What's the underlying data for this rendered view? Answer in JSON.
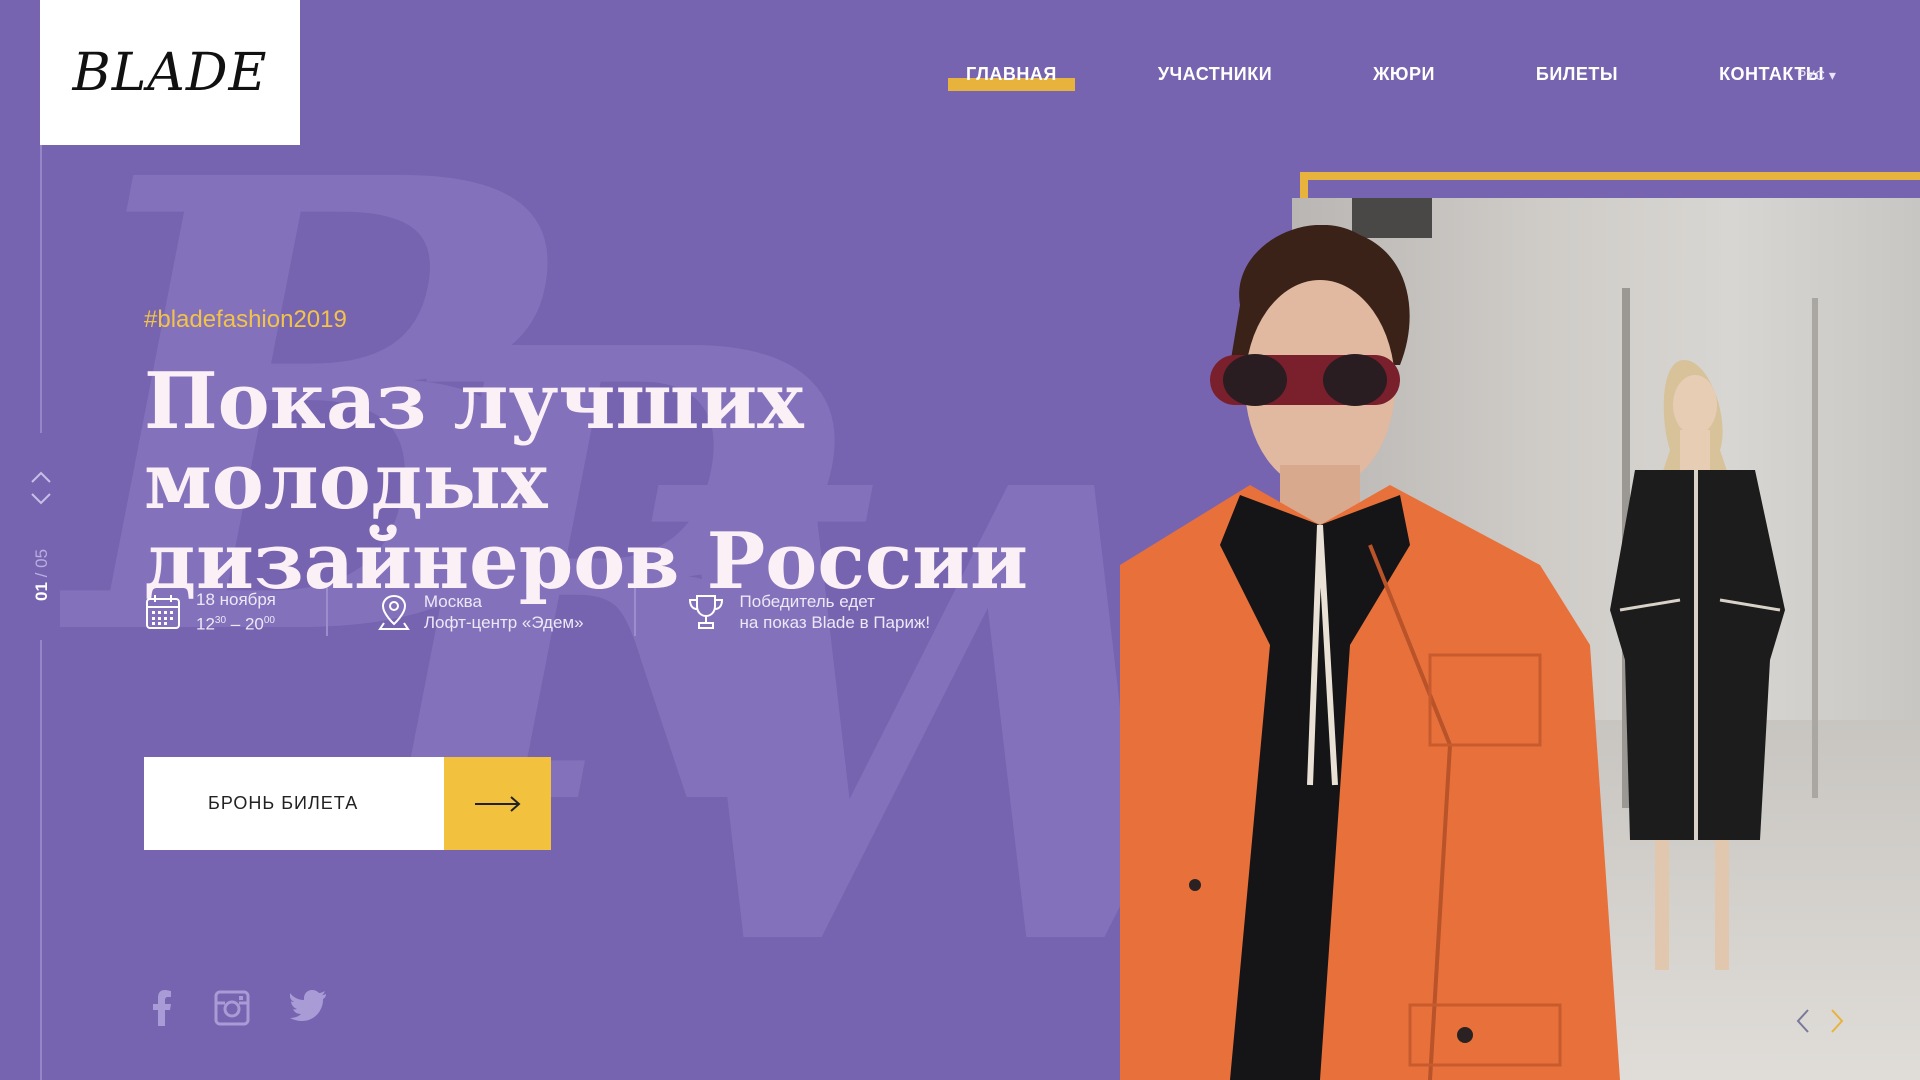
{
  "logo": {
    "text": "BLADE"
  },
  "nav": {
    "items": [
      {
        "label": "ГЛАВНАЯ",
        "active": true
      },
      {
        "label": "УЧАСТНИКИ"
      },
      {
        "label": "ЖЮРИ"
      },
      {
        "label": "БИЛЕТЫ"
      },
      {
        "label": "КОНТАКТЫ"
      }
    ],
    "language": "РУС ▾"
  },
  "background_letters": [
    "B",
    "R",
    "W"
  ],
  "slide_counter": {
    "current": "01",
    "separator": "/",
    "total": "05"
  },
  "hero": {
    "hashtag": "#bladefashion2019",
    "headline_line1": "Показ лучших молодых",
    "headline_line2": "дизайнеров России"
  },
  "info": {
    "date": {
      "line1": "18 ноября",
      "start_hour": "12",
      "start_min": "30",
      "dash": " – ",
      "end_hour": "20",
      "end_min": "00",
      "icon": "calendar-icon"
    },
    "location": {
      "line1": "Москва",
      "line2": "Лофт-центр «Эдем»",
      "icon": "location-pin-icon"
    },
    "prize": {
      "line1": "Победитель едет",
      "line2": "на показ Blade в Париж!",
      "icon": "trophy-icon"
    }
  },
  "cta": {
    "label": "БРОНЬ БИЛЕТА"
  },
  "social": [
    "facebook-icon",
    "instagram-icon",
    "twitter-icon"
  ],
  "colors": {
    "background": "#7764b0",
    "accent": "#f2c23e",
    "headline": "#fbf0f6"
  }
}
